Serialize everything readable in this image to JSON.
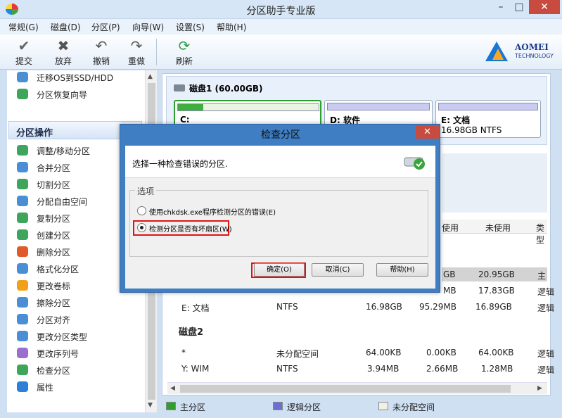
{
  "window": {
    "title": "分区助手专业版",
    "min": "–",
    "max": "□",
    "close": "✕"
  },
  "menu": [
    "常规(G)",
    "磁盘(D)",
    "分区(P)",
    "向导(W)",
    "设置(S)",
    "帮助(H)"
  ],
  "toolbar": {
    "commit": "提交",
    "discard": "放弃",
    "undo": "撤销",
    "redo": "重做",
    "refresh": "刷新"
  },
  "logo": {
    "line1": "AOMEI",
    "line2": "TECHNOLOGY"
  },
  "sidebar": {
    "wizards": [
      "迁移OS到SSD/HDD",
      "分区恢复向导"
    ],
    "ops_title": "分区操作",
    "ops": [
      "调整/移动分区",
      "合并分区",
      "切割分区",
      "分配自由空间",
      "复制分区",
      "创建分区",
      "删除分区",
      "格式化分区",
      "更改卷标",
      "擦除分区",
      "分区对齐",
      "更改分区类型",
      "更改序列号",
      "检查分区",
      "属性"
    ]
  },
  "disk1": {
    "title": "磁盘1 (60.00GB)",
    "parts": [
      {
        "name": "C:",
        "info": ""
      },
      {
        "name": "D: 软件",
        "info": ""
      },
      {
        "name": "E: 文档",
        "info": "16.98GB NTFS"
      }
    ]
  },
  "table": {
    "headers": [
      "使用",
      "未使用",
      "类型"
    ],
    "row_c": {
      "cap": "GB",
      "free": "20.95GB",
      "type": "主"
    },
    "row_d": {
      "used": "MB",
      "free": "17.83GB",
      "type": "逻辑"
    },
    "row_e": {
      "name": "E: 文档",
      "fs": "NTFS",
      "cap": "16.98GB",
      "used": "95.29MB",
      "free": "16.89GB",
      "type": "逻辑"
    },
    "disk2_title": "磁盘2",
    "rows2": [
      {
        "name": "*",
        "fs": "未分配空间",
        "cap": "64.00KB",
        "used": "0.00KB",
        "free": "64.00KB",
        "type": "逻辑"
      },
      {
        "name": "Y: WIM",
        "fs": "NTFS",
        "cap": "3.94MB",
        "used": "2.66MB",
        "free": "1.28MB",
        "type": "逻辑"
      }
    ]
  },
  "legend": {
    "primary": "主分区",
    "logical": "逻辑分区",
    "unallocated": "未分配空间"
  },
  "colors": {
    "primary": "#2e9e2e",
    "logical": "#6b6fd0",
    "unallocated": "#f2efe4",
    "accent": "#3f7ec3"
  },
  "dialog": {
    "title": "检查分区",
    "close": "✕",
    "prompt": "选择一种检查错误的分区.",
    "group": "选项",
    "option1": "使用chkdsk.exe程序检测分区的错误(E)",
    "option2": "检测分区是否有坏扇区(W)",
    "ok": "确定(O)",
    "cancel": "取消(C)",
    "help": "帮助(H)"
  }
}
